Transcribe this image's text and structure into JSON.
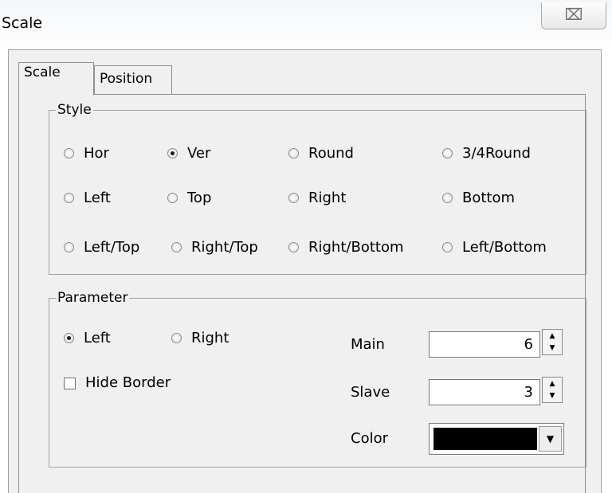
{
  "window": {
    "title": "Scale",
    "close_glyph": "⌧"
  },
  "tabs": [
    {
      "label": "Scale",
      "active": true
    },
    {
      "label": "Position",
      "active": false
    }
  ],
  "style_group": {
    "title": "Style",
    "options": [
      {
        "label": "Hor",
        "checked": false
      },
      {
        "label": "Ver",
        "checked": true
      },
      {
        "label": "Round",
        "checked": false
      },
      {
        "label": "3/4Round",
        "checked": false
      },
      {
        "label": "Left",
        "checked": false
      },
      {
        "label": "Top",
        "checked": false
      },
      {
        "label": "Right",
        "checked": false
      },
      {
        "label": "Bottom",
        "checked": false
      },
      {
        "label": "Left/Top",
        "checked": false
      },
      {
        "label": "Right/Top",
        "checked": false
      },
      {
        "label": "Right/Bottom",
        "checked": false
      },
      {
        "label": "Left/Bottom",
        "checked": false
      }
    ]
  },
  "parameter_group": {
    "title": "Parameter",
    "side_options": [
      {
        "label": "Left",
        "checked": true
      },
      {
        "label": "Right",
        "checked": false
      }
    ],
    "hide_border": {
      "label": "Hide Border",
      "checked": false
    },
    "main": {
      "label": "Main",
      "value": "6"
    },
    "slave": {
      "label": "Slave",
      "value": "3"
    },
    "color": {
      "label": "Color",
      "value": "#000000"
    },
    "spin_up_glyph": "▲",
    "spin_down_glyph": "▼",
    "combo_glyph": "▼"
  }
}
